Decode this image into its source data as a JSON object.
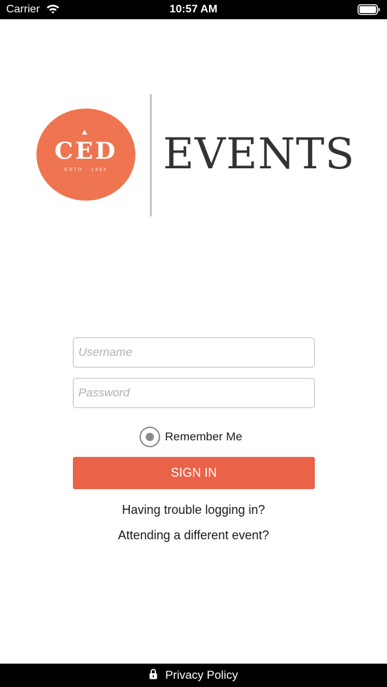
{
  "status_bar": {
    "carrier": "Carrier",
    "time": "10:57 AM",
    "icons": [
      "wifi-icon",
      "battery-icon"
    ]
  },
  "logo": {
    "letters": "CED",
    "established": "ESTD · 1964",
    "wordmark": "EVENTS",
    "accent_color": "#ef7450"
  },
  "login_form": {
    "username_placeholder": "Username",
    "password_placeholder": "Password",
    "remember_me_label": "Remember Me",
    "remember_me_checked": true,
    "sign_in_label": "SIGN IN",
    "sign_in_color": "#ea6247"
  },
  "links": {
    "trouble": "Having trouble logging in?",
    "different_event": "Attending a different event?"
  },
  "footer": {
    "privacy_label": "Privacy Policy",
    "icon": "lock-icon"
  }
}
